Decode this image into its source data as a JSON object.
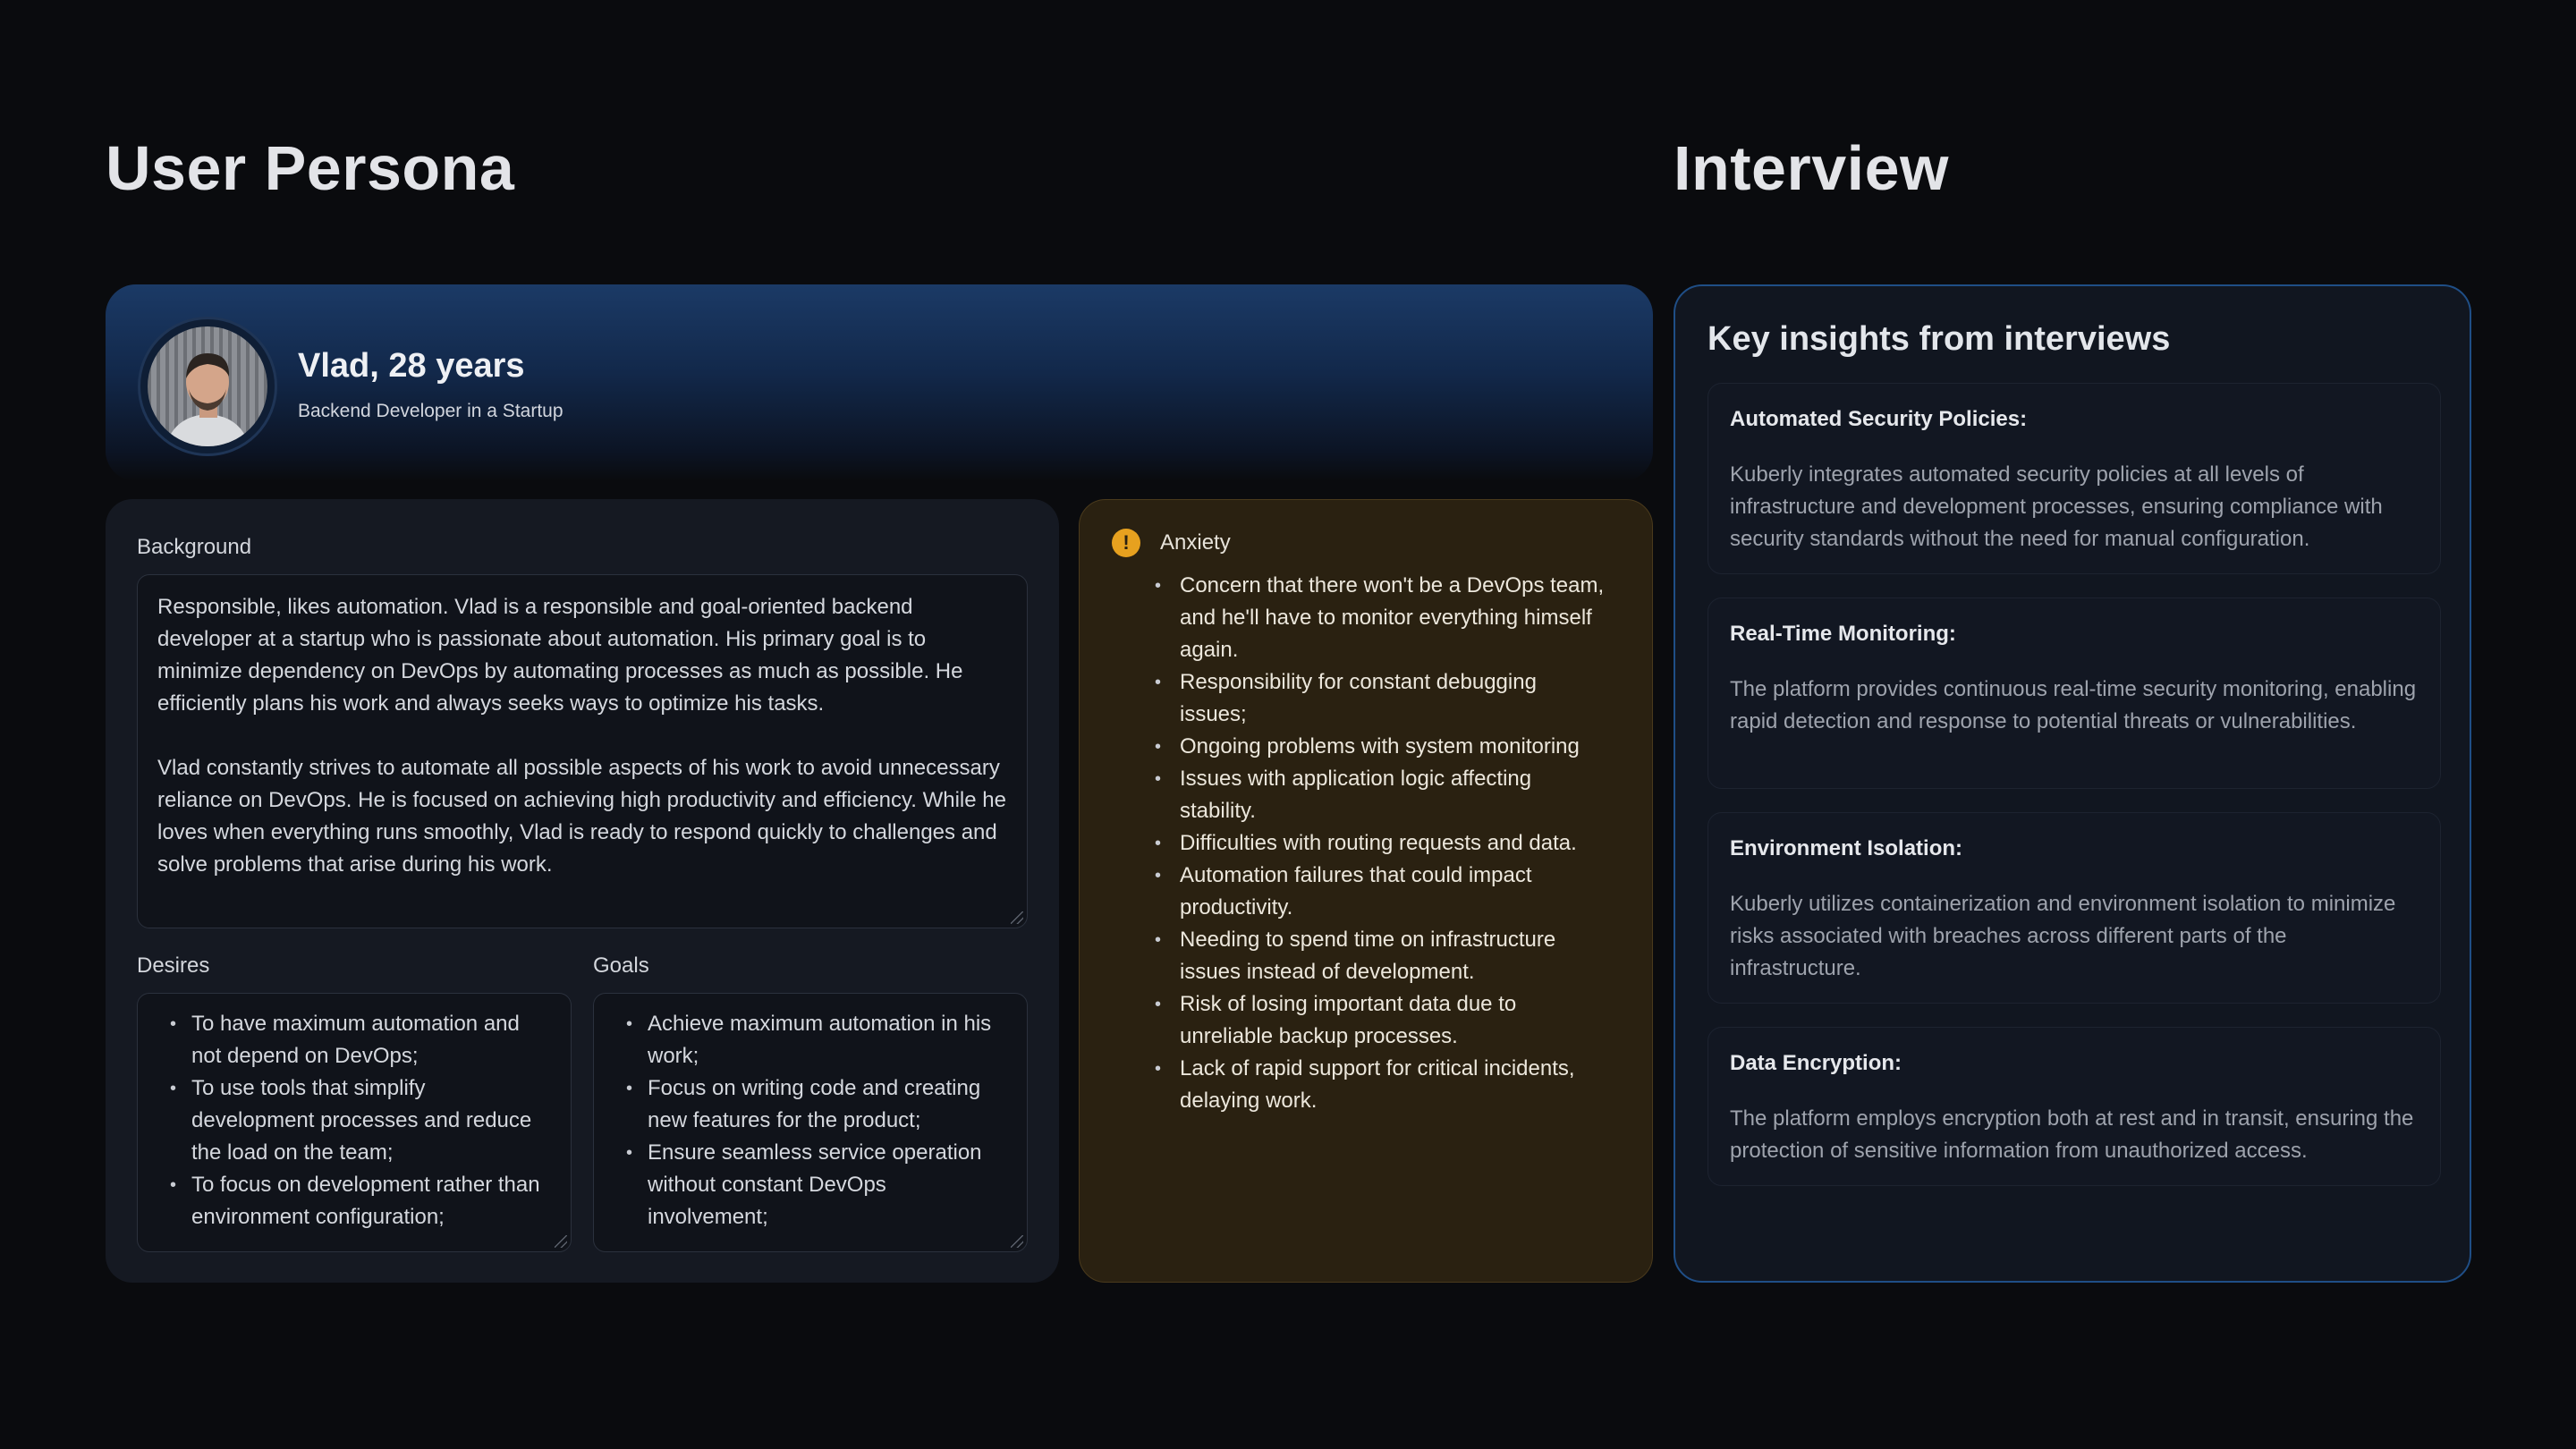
{
  "headings": {
    "persona": "User Persona",
    "interview": "Interview"
  },
  "persona": {
    "name": "Vlad, 28 years",
    "role": "Backend Developer in a Startup",
    "background_label": "Background",
    "background_paragraphs": [
      "Responsible, likes automation. Vlad is a responsible and goal-oriented backend developer at a startup who is passionate about automation. His primary goal is to minimize dependency on DevOps by automating processes as much as possible. He efficiently plans his work and always seeks ways to optimize his tasks.",
      "Vlad constantly strives to automate all possible aspects of his work to avoid unnecessary reliance on DevOps. He is focused on achieving high productivity and efficiency. While he loves when everything runs smoothly, Vlad is ready to respond quickly to challenges and solve problems that arise during his work."
    ],
    "desires_label": "Desires",
    "desires": [
      "To have maximum automation and not depend on DevOps;",
      "To use tools that simplify development processes and reduce the load on the team;",
      "To focus on development rather than environment configuration;"
    ],
    "goals_label": "Goals",
    "goals": [
      "Achieve maximum automation in his work;",
      "Focus on writing code and creating new features for the product;",
      "Ensure seamless service operation without constant DevOps involvement;"
    ]
  },
  "anxiety": {
    "title": "Anxiety",
    "icon": "warning-icon",
    "items": [
      "Concern that there won't be a DevOps team, and he'll have to monitor everything himself again.",
      "Responsibility for constant debugging issues;",
      "Ongoing problems with system monitoring",
      "Issues with application logic affecting stability.",
      "Difficulties with routing requests and data.",
      "Automation failures that could impact productivity.",
      "Needing to spend time on infrastructure issues instead of development.",
      "Risk of losing important data due to unreliable backup processes.",
      "Lack of rapid support for critical incidents, delaying work."
    ]
  },
  "interview": {
    "heading": "Key insights from interviews",
    "insights": [
      {
        "title": "Automated Security Policies:",
        "text": "Kuberly integrates automated security policies at all levels of infrastructure and development processes, ensuring compliance with security standards without the need for manual configuration."
      },
      {
        "title": "Real-Time Monitoring:",
        "text": "The platform provides continuous real-time security monitoring, enabling rapid detection and response to potential threats or vulnerabilities."
      },
      {
        "title": "Environment Isolation:",
        "text": "Kuberly utilizes containerization and environment isolation to minimize risks associated with breaches across different parts of the infrastructure."
      },
      {
        "title": "Data Encryption:",
        "text": "The platform employs encryption both at rest and in transit, ensuring the protection of sensitive information from unauthorized access."
      }
    ]
  },
  "colors": {
    "background": "#0a0b0e",
    "persona_header": "#1b3a66",
    "anxiety_bg": "#2a2111",
    "warning": "#e7a11f",
    "interview_border": "#1f4e86"
  }
}
